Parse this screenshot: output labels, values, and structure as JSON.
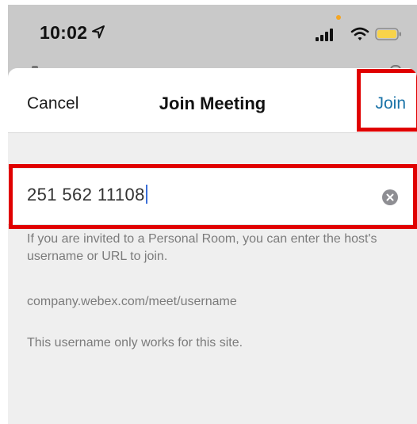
{
  "status_bar": {
    "time": "10:02",
    "icons": [
      "location-arrow-icon",
      "signal-icon",
      "wifi-icon",
      "battery-icon"
    ],
    "battery_color": "#f8d34a",
    "mic_indicator_color": "#f5a623"
  },
  "navbar": {
    "cancel_label": "Cancel",
    "title": "Join Meeting",
    "join_label": "Join"
  },
  "meeting_input": {
    "value": "251 562 11108",
    "clear_icon": "clear-icon"
  },
  "help": {
    "line1": "If you are invited to a Personal Room, you can enter the host's username or URL to join.",
    "example": "company.webex.com/meet/username",
    "note": "This username only works for this site."
  },
  "colors": {
    "accent": "#1a73a8",
    "highlight": "#e00000"
  }
}
